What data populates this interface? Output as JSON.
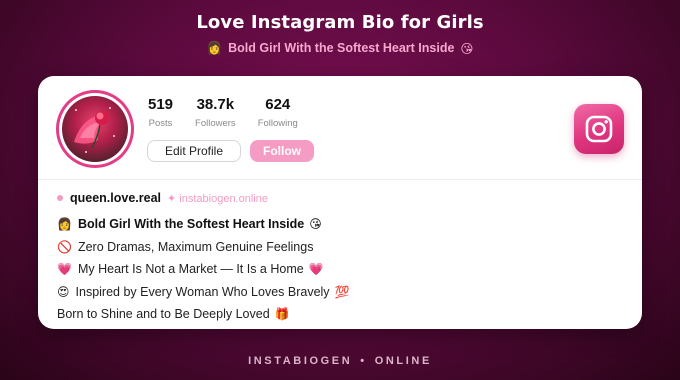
{
  "header": {
    "title": "Love Instagram Bio for Girls",
    "subtitle": "Bold Girl With the Softest Heart Inside",
    "subtitle_icon_before": "👩",
    "subtitle_icon_after": "😘"
  },
  "profile": {
    "avatar_icon": "rose-photo",
    "stats": [
      {
        "value": "519",
        "label": "Posts"
      },
      {
        "value": "38.7k",
        "label": "Followers"
      },
      {
        "value": "624",
        "label": "Following"
      }
    ],
    "edit_button": "Edit Profile",
    "follow_button": "Follow",
    "logo_icon": "instagram-icon"
  },
  "bio": {
    "username": "queen.love.real",
    "site": "✦ instabiogen.online",
    "lines": [
      {
        "icon": "👩",
        "text": "Bold Girl With the Softest Heart Inside",
        "icon_after": "😘"
      },
      {
        "icon": "🚫",
        "text": "Zero Dramas, Maximum Genuine Feelings",
        "icon_after": ""
      },
      {
        "icon": "💗",
        "text": "My Heart Is Not a Market — It Is a Home",
        "icon_after": "💗"
      },
      {
        "icon": "😍",
        "text": "Inspired by Every Woman Who Loves Bravely",
        "icon_after": "💯"
      },
      {
        "icon": "",
        "text": "Born to Shine and to Be Deeply Loved",
        "icon_after": "🎁"
      }
    ]
  },
  "footer": {
    "left": "INSTABIOGEN",
    "separator": "•",
    "right": "ONLINE"
  },
  "colors": {
    "background": "#5c0a3e",
    "accent_pink": "#f49cc4",
    "ring_pink": "#e23d86"
  }
}
